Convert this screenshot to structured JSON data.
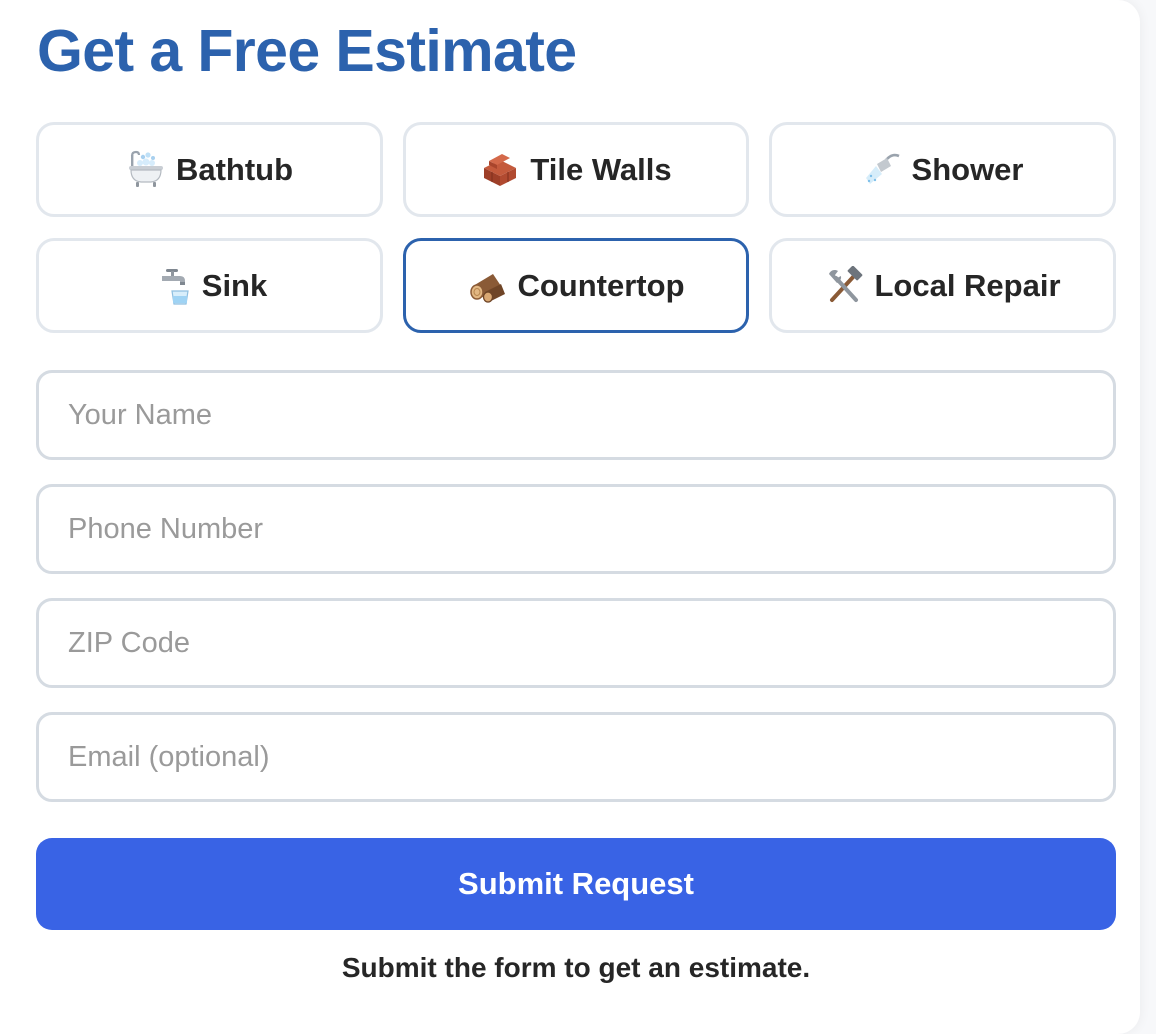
{
  "form": {
    "title": "Get a Free Estimate",
    "services": [
      {
        "label": "Bathtub",
        "icon": "bathtub-icon",
        "selected": false
      },
      {
        "label": "Tile Walls",
        "icon": "bricks-icon",
        "selected": false
      },
      {
        "label": "Shower",
        "icon": "shower-icon",
        "selected": false
      },
      {
        "label": "Sink",
        "icon": "faucet-icon",
        "selected": false
      },
      {
        "label": "Countertop",
        "icon": "wood-log-icon",
        "selected": true
      },
      {
        "label": "Local Repair",
        "icon": "hammer-wrench-icon",
        "selected": false
      }
    ],
    "fields": {
      "name": {
        "placeholder": "Your Name",
        "value": ""
      },
      "phone": {
        "placeholder": "Phone Number",
        "value": ""
      },
      "zip": {
        "placeholder": "ZIP Code",
        "value": ""
      },
      "email": {
        "placeholder": "Email (optional)",
        "value": ""
      }
    },
    "submit_label": "Submit Request",
    "status_text": "Submit the form to get an estimate."
  },
  "colors": {
    "title": "#2c62ad",
    "selected_border": "#2c62ad",
    "default_border": "#e2e7ed",
    "submit_bg": "#3963e5",
    "text": "#262626",
    "placeholder": "#9a9a9a"
  }
}
